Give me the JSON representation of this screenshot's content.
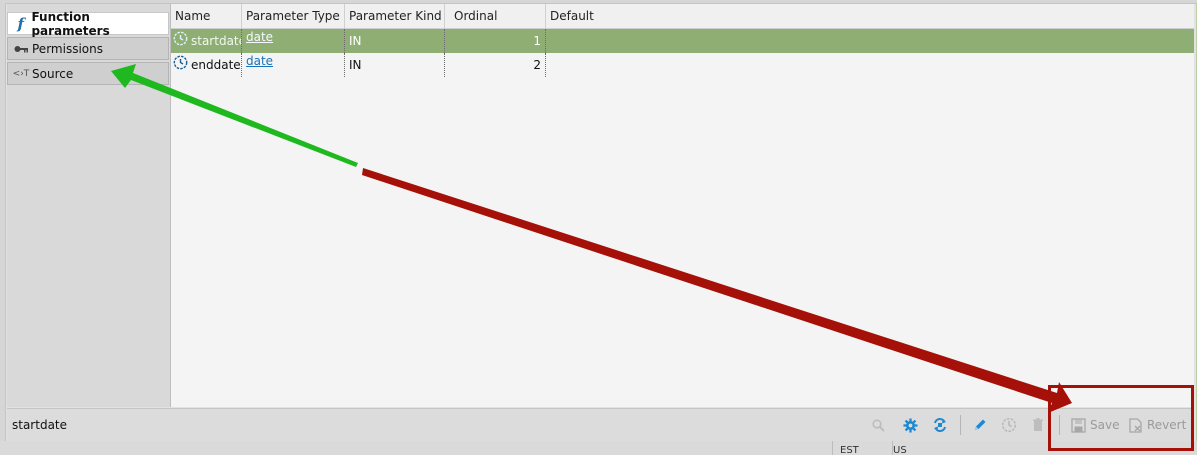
{
  "sidebar": {
    "tabs": [
      {
        "label": "Function parameters",
        "icon": "function-icon",
        "active": true
      },
      {
        "label": "Permissions",
        "icon": "key-icon",
        "active": false
      },
      {
        "label": "Source",
        "icon": "source-code-icon",
        "active": false
      }
    ]
  },
  "grid": {
    "columns": [
      "Name",
      "Parameter Type",
      "Parameter Kind",
      "Ordinal Position",
      "Default"
    ],
    "rows": [
      {
        "name": "startdate",
        "type": "date",
        "kind": "IN",
        "ordinal": "1",
        "default": "",
        "selected": true
      },
      {
        "name": "enddate",
        "type": "date",
        "kind": "IN",
        "ordinal": "2",
        "default": "",
        "selected": false
      }
    ]
  },
  "statusbar": {
    "text": "startdate",
    "save_label": "Save",
    "revert_label": "Revert"
  },
  "bottom": {
    "cell1": "EST",
    "cell2": "US"
  },
  "colors": {
    "selected_row": "#8fae74",
    "link": "#1a72b8",
    "annotation_green": "#1fb81f",
    "annotation_red": "#a51108",
    "tool_blue": "#1e88d0"
  }
}
